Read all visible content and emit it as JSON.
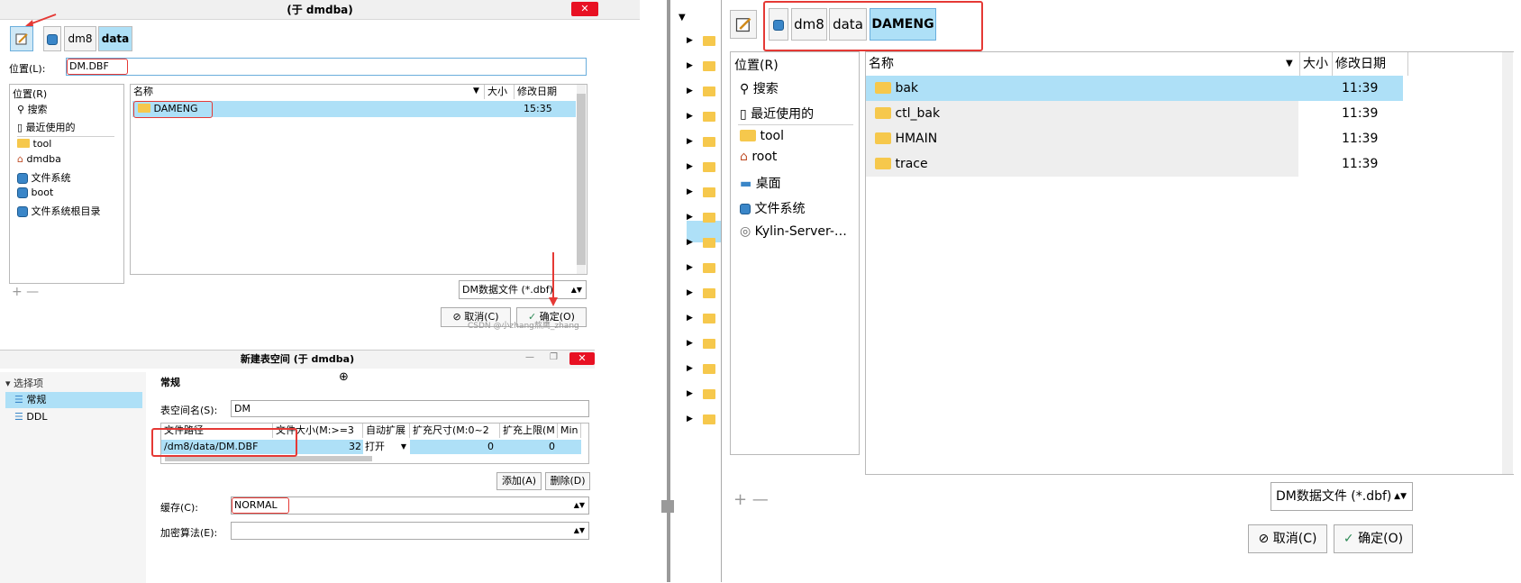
{
  "left_dialog": {
    "title": "(于 dmdba)",
    "path_buttons": [
      "dm8",
      "data"
    ],
    "location_label": "位置(L):",
    "location_value": "DM.DBF",
    "places_header": "位置(R)",
    "places": [
      "搜索",
      "最近使用的",
      "tool",
      "dmdba",
      "文件系统",
      "boot",
      "文件系统根目录"
    ],
    "columns": [
      "名称",
      "大小",
      "修改日期"
    ],
    "files": [
      {
        "name": "DAMENG",
        "date": "15:35"
      }
    ],
    "filter": "DM数据文件 (*.dbf)",
    "cancel": "取消(C)",
    "ok": "确定(O)",
    "watermark": "CSDN @小zhang熬鹰_zhang"
  },
  "tablespace_dialog": {
    "title": "新建表空间 (于 dmdba)",
    "options_header": "选择项",
    "options": [
      "常规",
      "DDL"
    ],
    "section": "常规",
    "name_label": "表空间名(S):",
    "name_value": "DM",
    "grid_columns": [
      "文件路径",
      "文件大小(M:>=3",
      "自动扩展",
      "扩充尺寸(M:0~2",
      "扩充上限(M",
      "Min"
    ],
    "grid_row": {
      "path": "/dm8/data/DM.DBF",
      "size": "32",
      "auto": "打开",
      "ext": "0",
      "limit": "0"
    },
    "add": "添加(A)",
    "delete": "删除(D)",
    "cache_label": "缓存(C):",
    "cache_value": "NORMAL",
    "encrypt_label": "加密算法(E):"
  },
  "right_dialog": {
    "path_buttons": [
      "dm8",
      "data",
      "DAMENG"
    ],
    "places_header": "位置(R)",
    "places": [
      "搜索",
      "最近使用的",
      "tool",
      "root",
      "桌面",
      "文件系统",
      "Kylin-Server-…"
    ],
    "columns": [
      "名称",
      "大小",
      "修改日期"
    ],
    "files": [
      {
        "name": "bak",
        "date": "11:39"
      },
      {
        "name": "ctl_bak",
        "date": "11:39"
      },
      {
        "name": "HMAIN",
        "date": "11:39"
      },
      {
        "name": "trace",
        "date": "11:39"
      }
    ],
    "filter": "DM数据文件 (*.dbf)",
    "cancel": "取消(C)",
    "ok": "确定(O)"
  },
  "colors": {
    "selection": "#aee0f7",
    "highlight_red": "#e53935",
    "folder": "#f6c84c"
  }
}
